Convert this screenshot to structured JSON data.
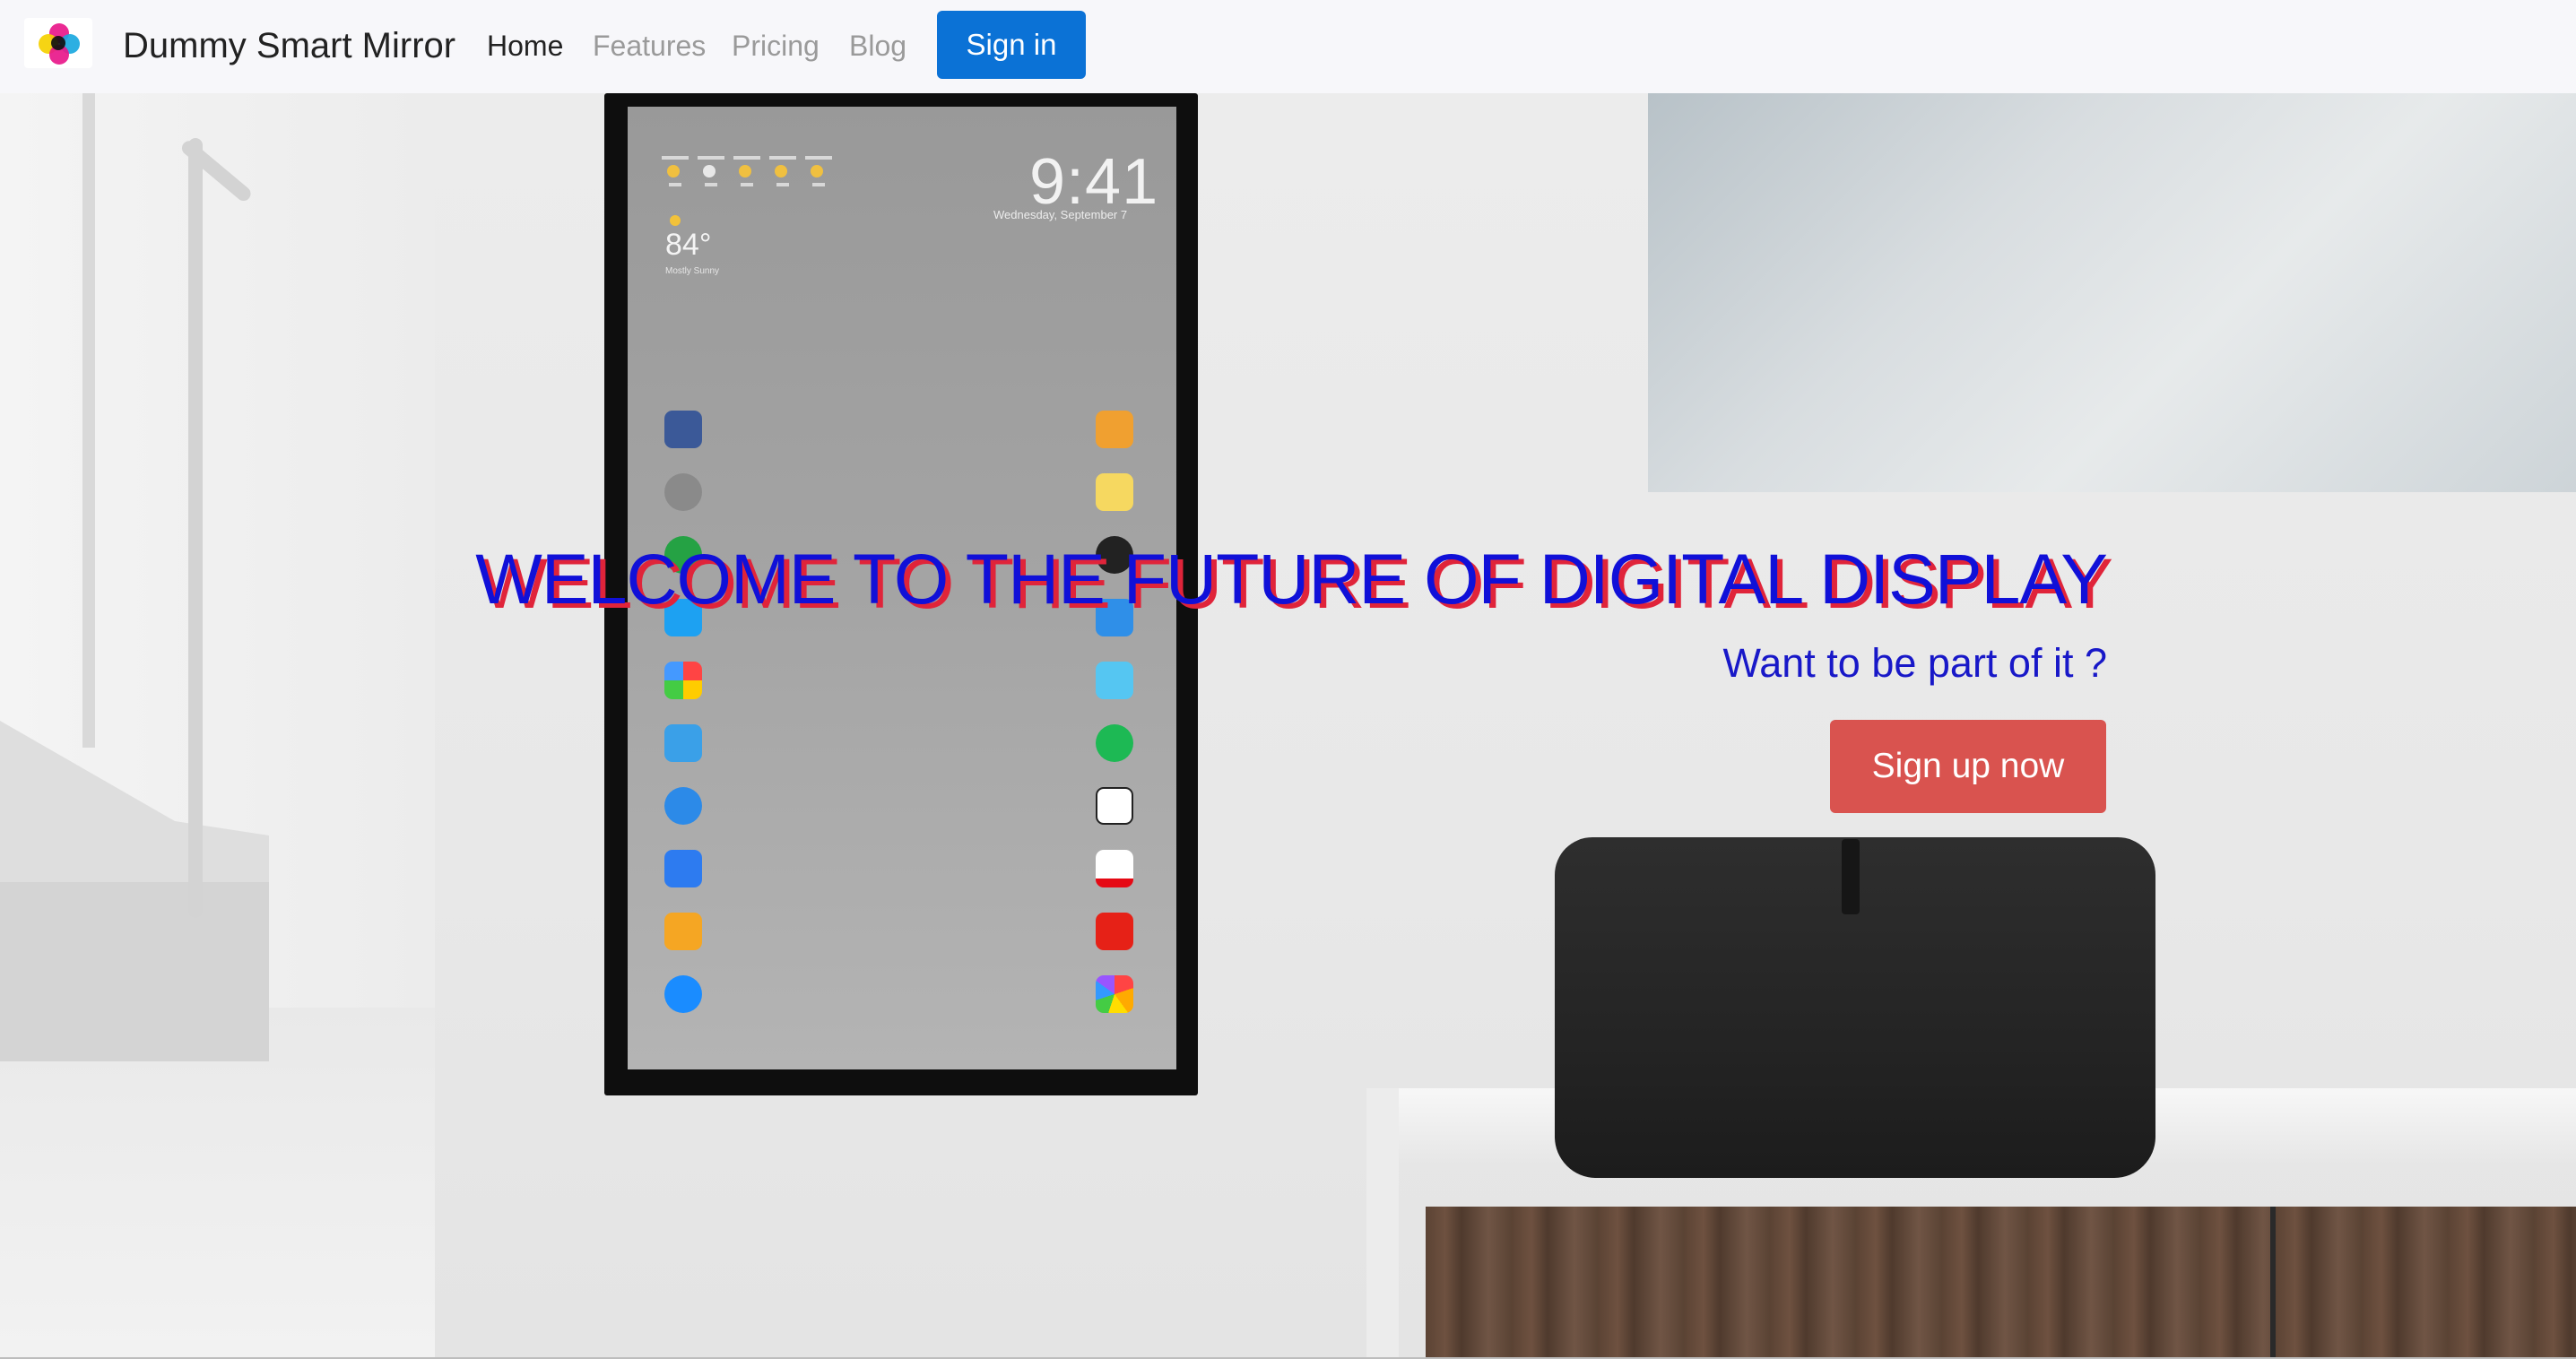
{
  "brand": {
    "name": "Dummy Smart Mirror",
    "logo_colors": [
      "#e8188a",
      "#f5d000",
      "#1aa8e0",
      "#111111"
    ]
  },
  "nav": {
    "items": [
      {
        "label": "Home",
        "active": true
      },
      {
        "label": "Features",
        "active": false
      },
      {
        "label": "Pricing",
        "active": false
      },
      {
        "label": "Blog",
        "active": false
      }
    ],
    "signin_label": "Sign in"
  },
  "hero": {
    "headline": "WELCOME TO THE FUTURE OF DIGITAL DISPLAY",
    "subheadline": "Want to be part of it ?",
    "cta_label": "Sign up now",
    "mirror": {
      "time": "9:41",
      "date": "Wednesday, September 7",
      "temperature": "84°",
      "condition": "Mostly Sunny"
    }
  },
  "colors": {
    "signin_button": "#0b72d6",
    "cta_button": "#d9534f",
    "headline_text": "#1010d8",
    "headline_shadow": "#e0243a",
    "subheadline_text": "#1818c8"
  }
}
